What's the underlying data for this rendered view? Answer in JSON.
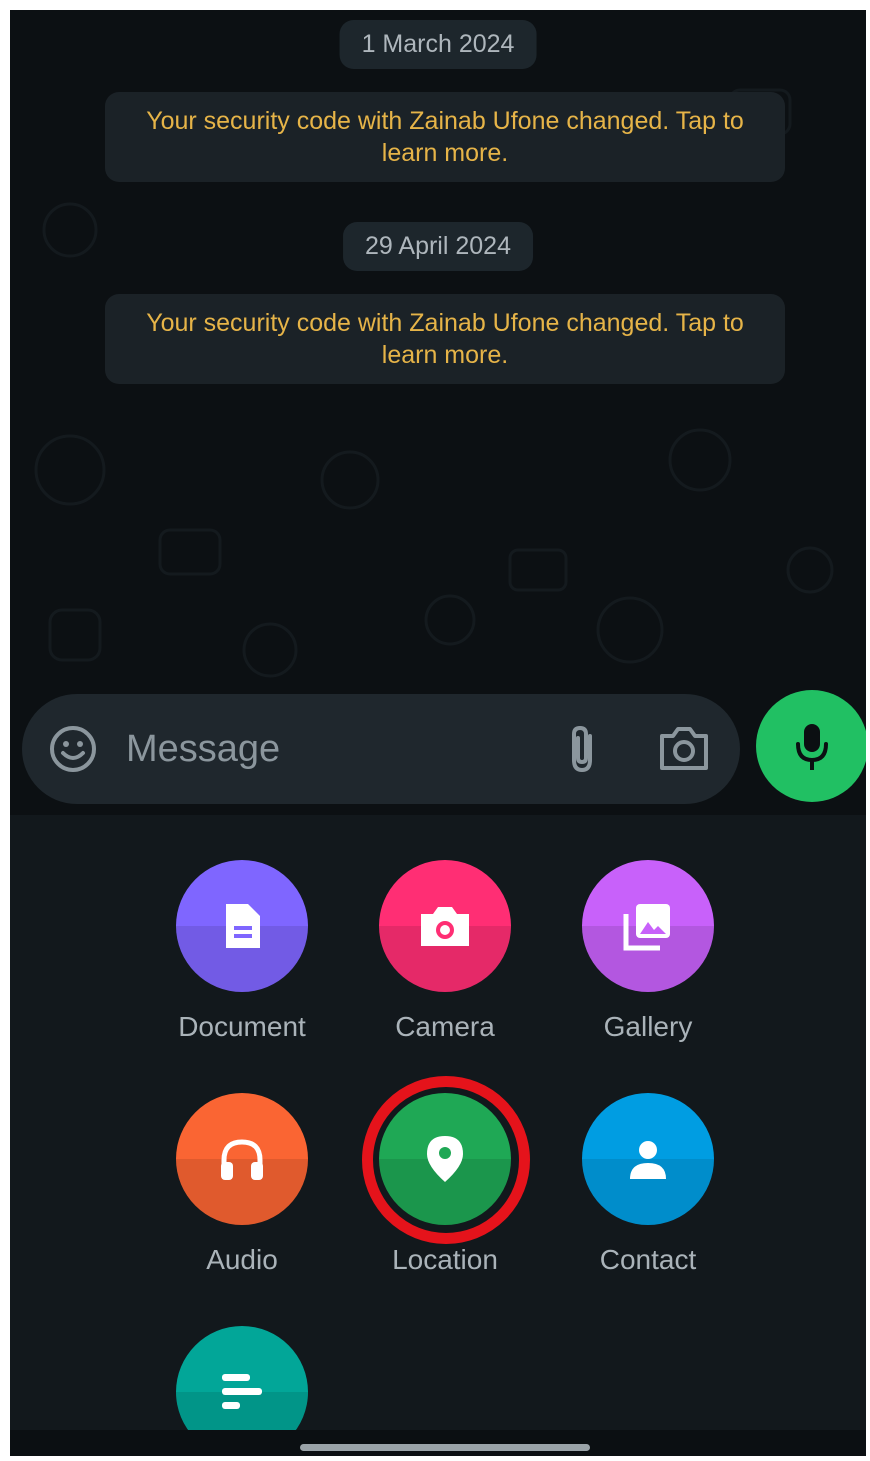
{
  "chat": {
    "date_1": "1 March 2024",
    "system_message_1": "Your security code with Zainab Ufone changed. Tap to learn more.",
    "date_2": "29 April 2024",
    "system_message_2": "Your security code with Zainab Ufone changed. Tap to learn more."
  },
  "composer": {
    "placeholder": "Message",
    "icons": [
      "emoji-icon",
      "paperclip-icon",
      "camera-icon",
      "microphone-icon"
    ]
  },
  "attachments": [
    {
      "label": "Document",
      "icon": "document-icon",
      "color": "#7f66ff"
    },
    {
      "label": "Camera",
      "icon": "camera-icon",
      "color": "#ff2e74"
    },
    {
      "label": "Gallery",
      "icon": "gallery-icon",
      "color": "#c861fa"
    },
    {
      "label": "Audio",
      "icon": "headphones-icon",
      "color": "#fa6533"
    },
    {
      "label": "Location",
      "icon": "location-pin-icon",
      "color": "#1fa855"
    },
    {
      "label": "Contact",
      "icon": "person-icon",
      "color": "#009de2"
    },
    {
      "label": "",
      "icon": "poll-icon",
      "color": "#02a698"
    }
  ],
  "colors": {
    "mic_button": "#21c063",
    "system_text": "#e6b448",
    "highlight_ring": "#e5131b"
  }
}
